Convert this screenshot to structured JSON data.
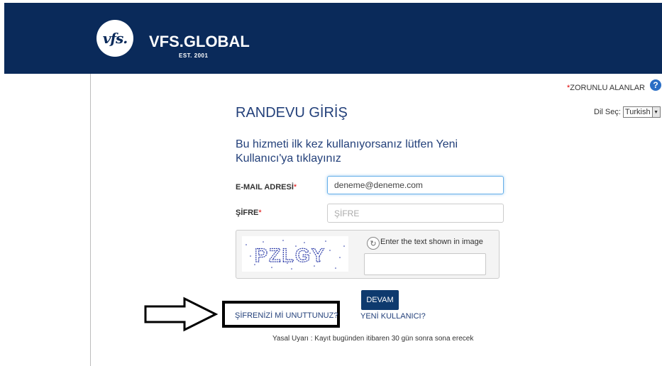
{
  "header": {
    "logo_text": "vfs.",
    "brand": "VFS.GLOBAL",
    "est": "EST. 2001",
    "bg_color": "#0a2a5a"
  },
  "required_note": {
    "star": "*",
    "text": "ZORUNLU ALANLAR"
  },
  "help_icon": {
    "icon": "help-icon",
    "glyph": "?"
  },
  "language": {
    "label": "Dil Seç:",
    "selected": "Turkish"
  },
  "page_title": "RANDEVU GİRİŞ",
  "info_text": "Bu hizmeti ilk kez kullanıyorsanız lütfen Yeni Kullanıcı'ya tıklayınız",
  "form": {
    "email_label": "E-MAIL ADRESİ",
    "email_value": "deneme@deneme.com",
    "password_label": "ŞİFRE",
    "password_placeholder": "ŞİFRE",
    "required_star": "*"
  },
  "captcha": {
    "image_text": "PZLGY",
    "hint": "Enter the text shown in image",
    "value": ""
  },
  "buttons": {
    "submit": "DEVAM"
  },
  "links": {
    "forgot_password": "ŞİFRENİZİ Mİ UNUTTUNUZ?",
    "new_user": "YENİ KULLANICI?"
  },
  "legal": "Yasal Uyarı : Kayıt bugünden itibaren 30 gün sonra sona erecek",
  "colors": {
    "accent": "#23407a",
    "button": "#0e3a6e",
    "required": "#d00000"
  }
}
